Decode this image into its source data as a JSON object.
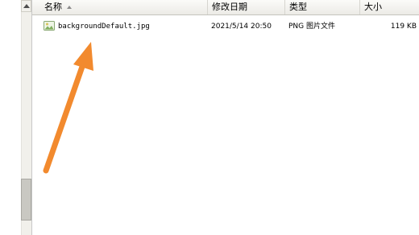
{
  "columns": {
    "name": "名称",
    "date": "修改日期",
    "type": "类型",
    "size": "大小"
  },
  "files": [
    {
      "name": "backgroundDefault.jpg",
      "modified": "2021/5/14 20:50",
      "type": "PNG 图片文件",
      "size": "119 KB",
      "icon": "image-file-icon"
    }
  ],
  "annotation": {
    "color": "#f28a2e",
    "shape": "arrow"
  }
}
